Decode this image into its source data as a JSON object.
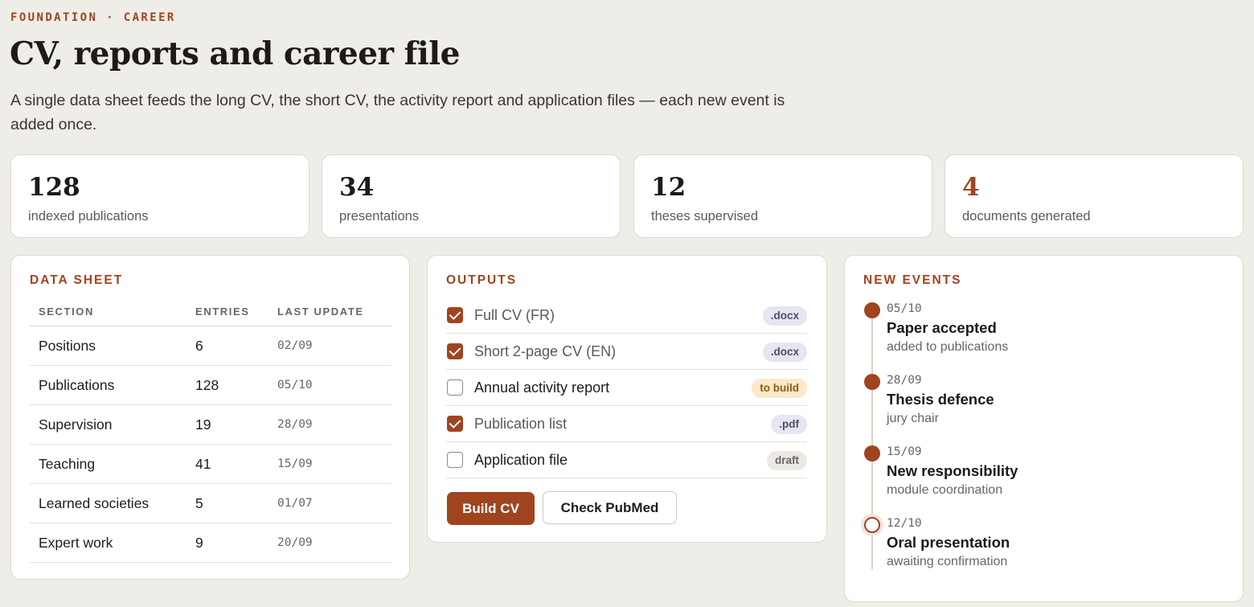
{
  "header": {
    "eyebrow": "FOUNDATION · CAREER",
    "title": "CV, reports and career file",
    "subtitle": "A single data sheet feeds the long CV, the short CV, the activity report and application files — each new event is added once."
  },
  "stats": [
    {
      "value": "128",
      "label": "indexed publications"
    },
    {
      "value": "34",
      "label": "presentations"
    },
    {
      "value": "12",
      "label": "theses supervised"
    },
    {
      "value": "4",
      "label": "documents generated"
    }
  ],
  "data_sheet": {
    "title": "DATA SHEET",
    "columns": [
      "SECTION",
      "ENTRIES",
      "LAST UPDATE"
    ],
    "rows": [
      {
        "section": "Positions",
        "entries": "6",
        "updated": "02/09"
      },
      {
        "section": "Publications",
        "entries": "128",
        "updated": "05/10"
      },
      {
        "section": "Supervision",
        "entries": "19",
        "updated": "28/09"
      },
      {
        "section": "Teaching",
        "entries": "41",
        "updated": "15/09"
      },
      {
        "section": "Learned societies",
        "entries": "5",
        "updated": "01/07"
      },
      {
        "section": "Expert work",
        "entries": "9",
        "updated": "20/09"
      }
    ]
  },
  "outputs": {
    "title": "OUTPUTS",
    "items": [
      {
        "label": "Full CV (FR)",
        "checked": true,
        "badge": ".docx"
      },
      {
        "label": "Short 2-page CV (EN)",
        "checked": true,
        "badge": ".docx"
      },
      {
        "label": "Annual activity report",
        "checked": false,
        "badge": "to build"
      },
      {
        "label": "Publication list",
        "checked": true,
        "badge": ".pdf"
      },
      {
        "label": "Application file",
        "checked": false,
        "badge": "draft"
      }
    ],
    "build_button": "Build CV",
    "check_button": "Check PubMed"
  },
  "events": {
    "title": "NEW EVENTS",
    "items": [
      {
        "date": "05/10",
        "title": "Paper accepted",
        "sub": "added to publications",
        "done": true
      },
      {
        "date": "28/09",
        "title": "Thesis defence",
        "sub": "jury chair",
        "done": true
      },
      {
        "date": "15/09",
        "title": "New responsibility",
        "sub": "module coordination",
        "done": true
      },
      {
        "date": "12/10",
        "title": "Oral presentation",
        "sub": "awaiting confirmation",
        "done": false
      }
    ]
  },
  "colors": {
    "accent": "#a0441f",
    "background": "#efede8",
    "card": "#ffffff"
  }
}
